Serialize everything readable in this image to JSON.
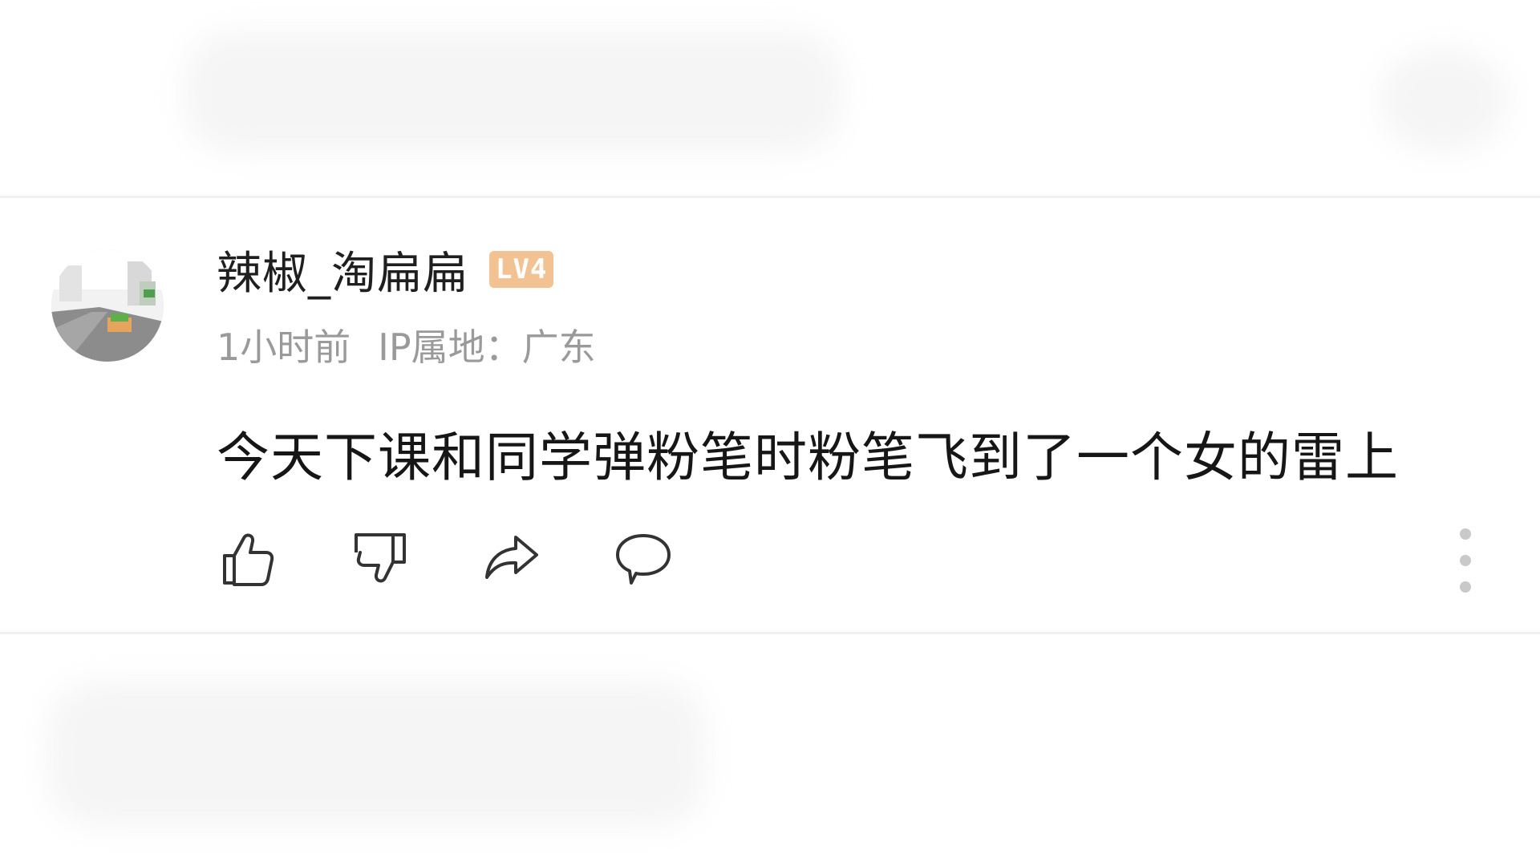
{
  "comment": {
    "username": "辣椒_淘扁扁",
    "level": "LV4",
    "time_ago": "1小时前",
    "ip_location": "IP属地：广东",
    "text": "今天下课和同学弹粉笔时粉笔飞到了一个女的雷上"
  },
  "actions": {
    "like_icon": "thumbs-up-icon",
    "dislike_icon": "thumbs-down-icon",
    "share_icon": "share-arrow-icon",
    "reply_icon": "speech-bubble-icon",
    "more_icon": "vertical-ellipsis-icon"
  },
  "colors": {
    "level_badge": "#f3c293",
    "meta_text": "#9a9a9a",
    "icon_stroke": "#333333",
    "divider": "#f0f0f0"
  }
}
